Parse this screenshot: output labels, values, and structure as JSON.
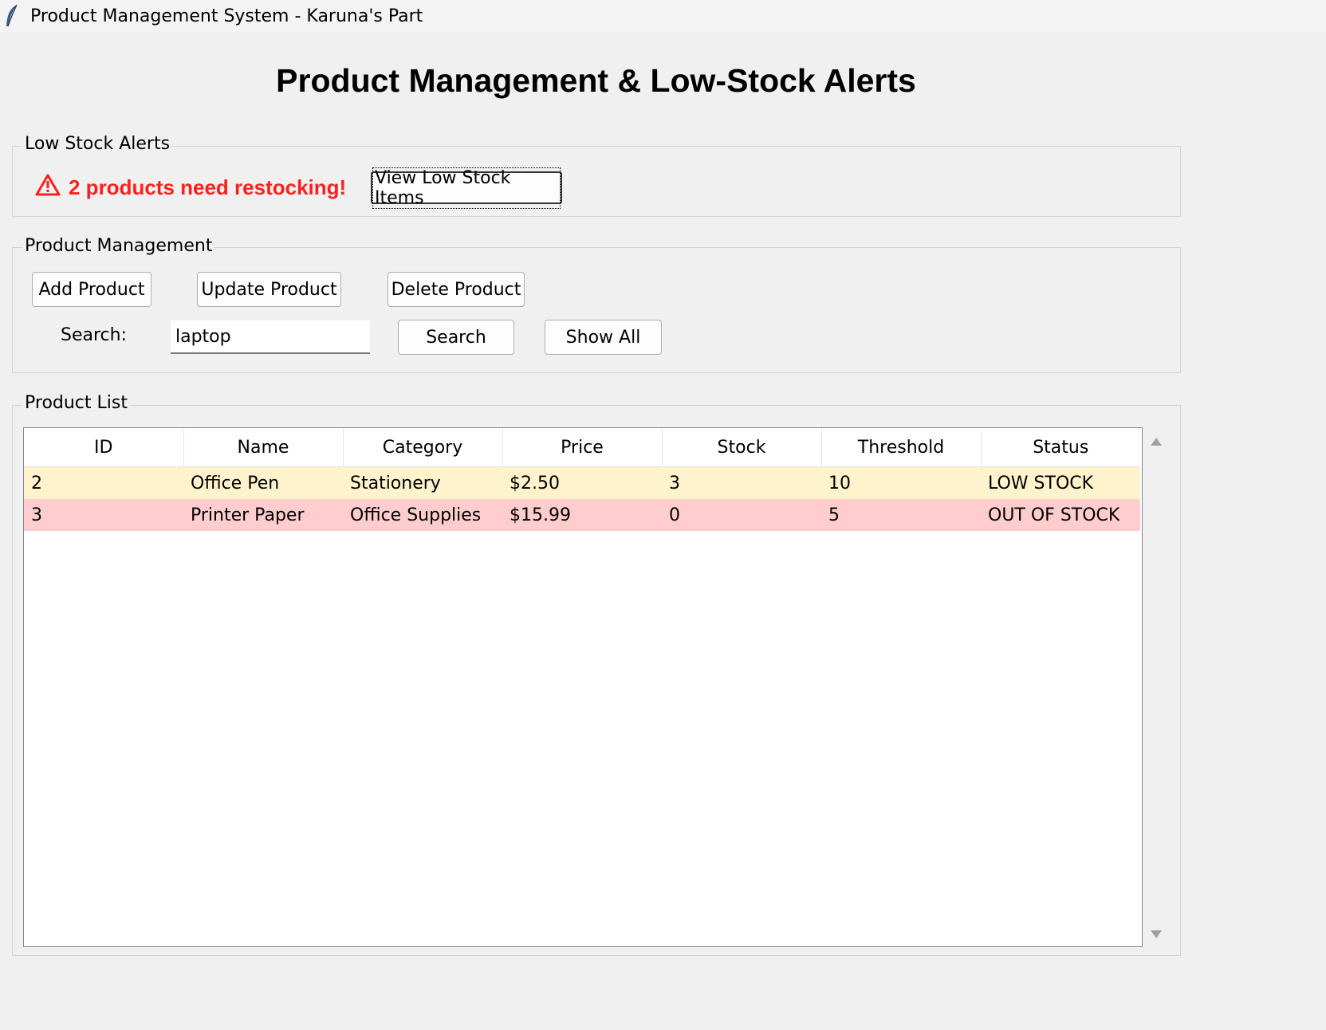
{
  "window": {
    "title": "Product Management System - Karuna's Part",
    "icon": "feather-icon"
  },
  "page": {
    "title": "Product Management & Low-Stock Alerts"
  },
  "alerts": {
    "group_label": "Low Stock Alerts",
    "icon": "warning-icon",
    "message": "2 products need restocking!",
    "view_button": "View Low Stock Items",
    "color": "#ff1f1f"
  },
  "management": {
    "group_label": "Product Management",
    "add_button": "Add Product",
    "update_button": "Update Product",
    "delete_button": "Delete Product",
    "search_label": "Search:",
    "search_value": "laptop",
    "search_button": "Search",
    "show_all_button": "Show All"
  },
  "product_list": {
    "group_label": "Product List",
    "columns": [
      "ID",
      "Name",
      "Category",
      "Price",
      "Stock",
      "Threshold",
      "Status"
    ],
    "rows": [
      {
        "id": "2",
        "name": "Office Pen",
        "category": "Stationery",
        "price": "$2.50",
        "stock": "3",
        "threshold": "10",
        "status": "LOW STOCK",
        "row_color": "#fff3cd"
      },
      {
        "id": "3",
        "name": "Printer Paper",
        "category": "Office Supplies",
        "price": "$15.99",
        "stock": "0",
        "threshold": "5",
        "status": "OUT OF STOCK",
        "row_color": "#ffcdcd"
      }
    ]
  }
}
